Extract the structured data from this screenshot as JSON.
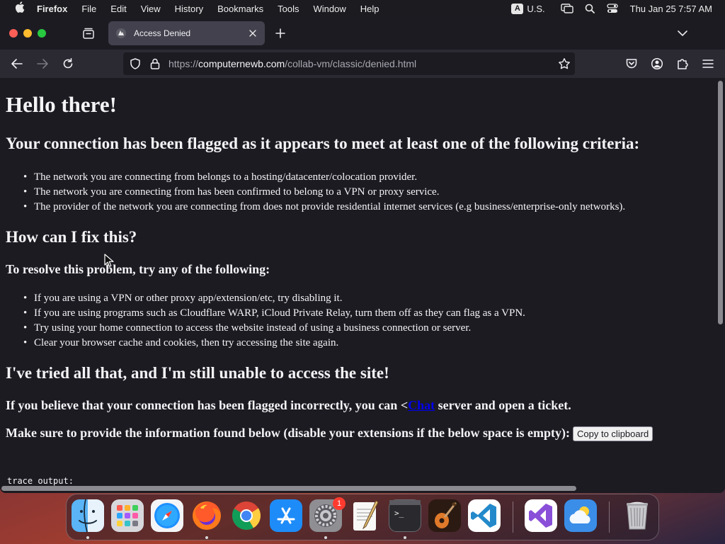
{
  "menubar": {
    "app_name": "Firefox",
    "menus": [
      "File",
      "Edit",
      "View",
      "History",
      "Bookmarks",
      "Tools",
      "Window",
      "Help"
    ],
    "input_source_badge": "A",
    "input_source": "U.S.",
    "clock": "Thu Jan 25  7:57 AM"
  },
  "browser": {
    "tab": {
      "title": "Access Denied"
    },
    "url": {
      "scheme": "https://",
      "host": "computernewb.com",
      "path": "/collab-vm/classic/denied.html"
    }
  },
  "page": {
    "heading": "Hello there!",
    "flagged_heading": "Your connection has been flagged as it appears to meet at least one of the following criteria:",
    "criteria": [
      "The network you are connecting from belongs to a hosting/datacenter/colocation provider.",
      "The network you are connecting from has been confirmed to belong to a VPN or proxy service.",
      "The provider of the network you are connecting from does not provide residential internet services (e.g business/enterprise-only networks)."
    ],
    "fix_heading": "How can I fix this?",
    "resolve_heading": "To resolve this problem, try any of the following:",
    "fixes": [
      "If you are using a VPN or other proxy app/extension/etc, try disabling it.",
      "If you are using programs such as Cloudflare WARP, iCloud Private Relay, turn them off as they can flag as a VPN.",
      "Try using your home connection to access the website instead of using a business connection or server.",
      "Clear your browser cache and cookies, then try accessing the site again."
    ],
    "still_heading": "I've tried all that, and I'm still unable to access the site!",
    "incorrect_prefix": "If you believe that your connection has been flagged incorrectly, you can <",
    "incorrect_link": "Chat",
    "incorrect_suffix": " server and open a ticket.",
    "info_text": "Make sure to provide the information found below (disable your extensions if the below space is empty):",
    "copy_button": "Copy to clipboard",
    "trace_label": "trace output:"
  },
  "dock": {
    "apps": [
      "finder",
      "launchpad",
      "safari",
      "firefox",
      "chrome",
      "app-store",
      "system-settings",
      "textedit",
      "terminal",
      "garageband",
      "vscode",
      "visual-studio",
      "weather",
      "trash"
    ],
    "system_settings_badge": "1",
    "terminal_prompt": ">_"
  },
  "colors": {
    "page_background": "#1c1b22",
    "toolbar": "#2b2a33",
    "link": "#0000ee",
    "text": "#f4f4f6"
  }
}
